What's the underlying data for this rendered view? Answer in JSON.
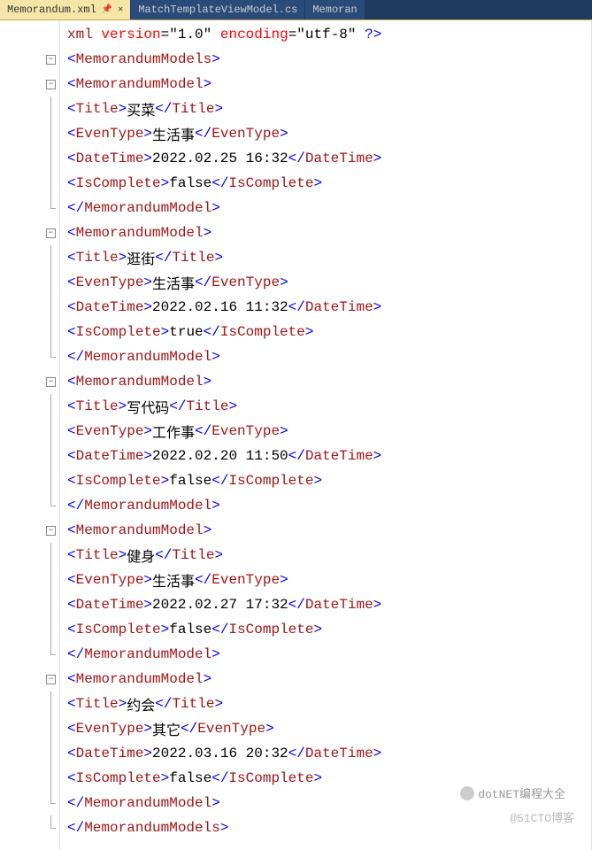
{
  "tabs": [
    {
      "label": "Memorandum.xml",
      "active": true
    },
    {
      "label": "MatchTemplateViewModel.cs",
      "active": false
    },
    {
      "label": "Memoran",
      "active": false
    }
  ],
  "xml_decl": {
    "open": "<?",
    "name": "xml",
    "attrs": [
      {
        "name": "version",
        "val": "\"1.0\""
      },
      {
        "name": "encoding",
        "val": "\"utf-8\""
      }
    ],
    "close": "?>"
  },
  "root": "MemorandumModels",
  "model_tag": "MemorandumModel",
  "field_tags": {
    "title": "Title",
    "eventype": "EvenType",
    "datetime": "DateTime",
    "iscomplete": "IsComplete"
  },
  "models": [
    {
      "indent": 0,
      "title": "买菜",
      "eventype": "生活事",
      "datetime": "2022.02.25 16:32",
      "iscomplete": "false"
    },
    {
      "indent": 0,
      "title": "逛街",
      "eventype": "生活事",
      "datetime": "2022.02.16 11:32",
      "iscomplete": "true"
    },
    {
      "indent": 1,
      "title": "写代码",
      "eventype": "工作事",
      "datetime": "2022.02.20 11:50",
      "iscomplete": "false"
    },
    {
      "indent": 1,
      "title": "健身",
      "eventype": "生活事",
      "datetime": "2022.02.27 17:32",
      "iscomplete": "false"
    },
    {
      "indent": 1,
      "title": "约会",
      "eventype": "其它",
      "datetime": "2022.03.16 20:32",
      "iscomplete": "false"
    }
  ],
  "watermark1": "dotNET编程大全",
  "watermark2": "@51CTO博客"
}
